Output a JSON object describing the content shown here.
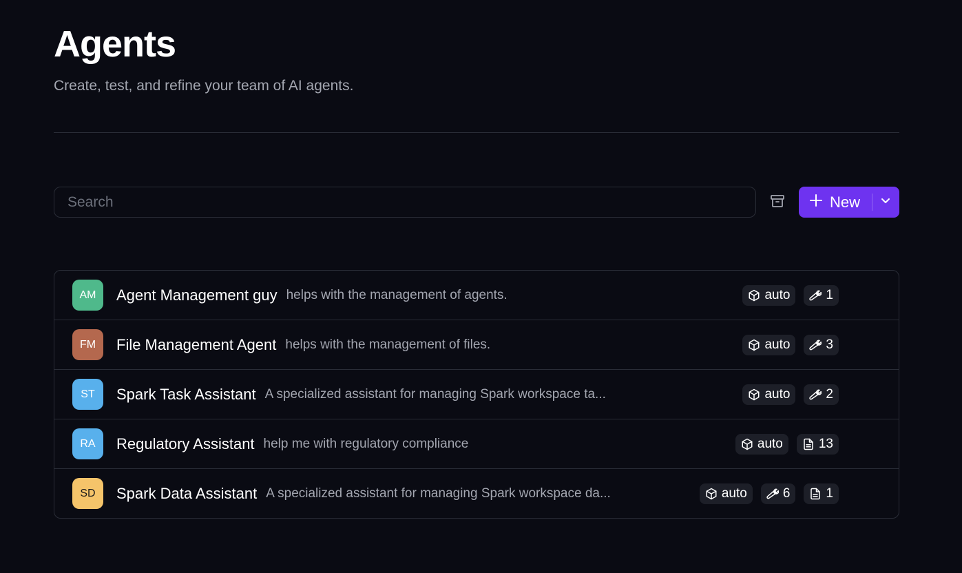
{
  "header": {
    "title": "Agents",
    "subtitle": "Create, test, and refine your team of AI agents."
  },
  "toolbar": {
    "search_placeholder": "Search",
    "search_value": "",
    "archive_icon": "archive-icon",
    "new_label": "New"
  },
  "agents": [
    {
      "initials": "AM",
      "avatar_color": "#4fb98b",
      "initials_color": "#ffffff",
      "name": "Agent Management guy",
      "description": "helps with the management of agents.",
      "model": "auto",
      "tools": "1",
      "files": null
    },
    {
      "initials": "FM",
      "avatar_color": "#b4684e",
      "initials_color": "#ffffff",
      "name": "File Management Agent",
      "description": "helps with the management of files.",
      "model": "auto",
      "tools": "3",
      "files": null
    },
    {
      "initials": "ST",
      "avatar_color": "#58b0ec",
      "initials_color": "#ffffff",
      "name": "Spark Task Assistant",
      "description": "A specialized assistant for managing Spark workspace ta...",
      "model": "auto",
      "tools": "2",
      "files": null
    },
    {
      "initials": "RA",
      "avatar_color": "#58b0ec",
      "initials_color": "#ffffff",
      "name": "Regulatory Assistant",
      "description": "help me with regulatory compliance",
      "model": "auto",
      "tools": null,
      "files": "13"
    },
    {
      "initials": "SD",
      "avatar_color": "#f5c46a",
      "initials_color": "#1a1a1a",
      "name": "Spark Data Assistant",
      "description": "A specialized assistant for managing Spark workspace da...",
      "model": "auto",
      "tools": "6",
      "files": "1"
    }
  ],
  "colors": {
    "background": "#0a0b13",
    "accent": "#6e33f0",
    "border": "#2a2d37",
    "badge_bg": "#1d1f28",
    "muted_text": "#a3a6b0"
  }
}
